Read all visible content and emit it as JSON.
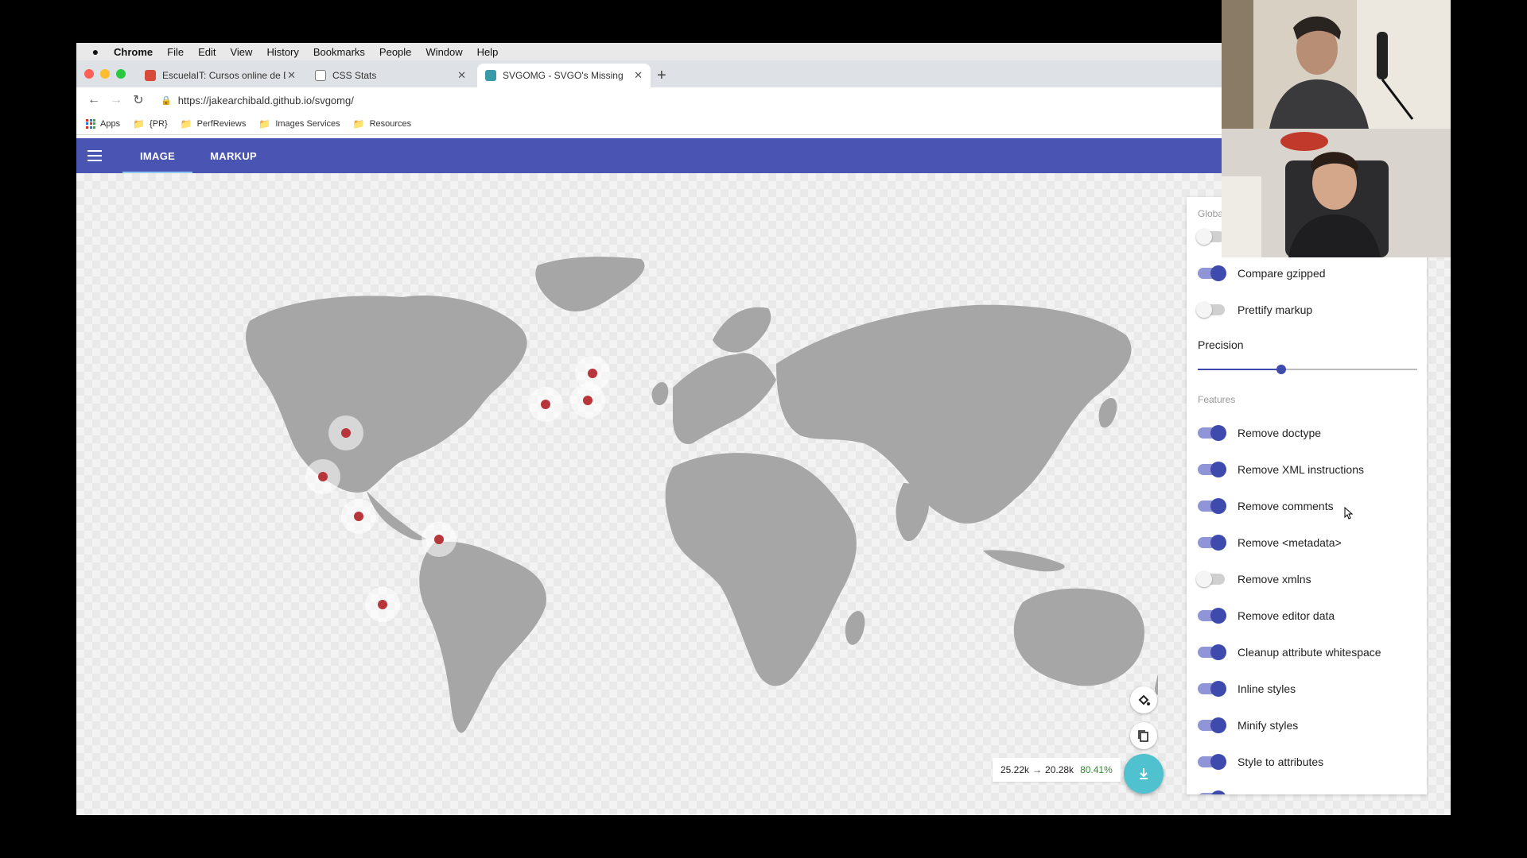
{
  "menubar": {
    "app": "Chrome",
    "items": [
      "File",
      "Edit",
      "View",
      "History",
      "Bookmarks",
      "People",
      "Window",
      "Help"
    ]
  },
  "tabs": [
    {
      "title": "EscuelaIT: Cursos online de De",
      "favicon_color": "#d84a38"
    },
    {
      "title": "CSS Stats",
      "favicon_color": "#444444"
    },
    {
      "title": "SVGOMG - SVGO's Missing GU",
      "favicon_color": "#3b9aa8"
    }
  ],
  "toolbar": {
    "url": "https://jakearchibald.github.io/svgomg/"
  },
  "bookmarks": {
    "apps": "Apps",
    "items": [
      "{PR}",
      "PerfReviews",
      "Images Services",
      "Resources"
    ]
  },
  "appbar": {
    "color": "#4a55b3",
    "tabs": [
      "IMAGE",
      "MARKUP"
    ]
  },
  "savings": {
    "from": "25.22k",
    "arrow": "→",
    "to": "20.28k",
    "percent": "80.41%"
  },
  "settings": {
    "global_label": "Global",
    "toggles_top": [
      {
        "label": "Compare gzipped",
        "on": true
      },
      {
        "label": "Prettify markup",
        "on": false
      }
    ],
    "precision_label": "Precision",
    "precision_value": 0.38,
    "features_label": "Features",
    "features": [
      {
        "label": "Remove doctype",
        "on": true
      },
      {
        "label": "Remove XML instructions",
        "on": true
      },
      {
        "label": "Remove comments",
        "on": true
      },
      {
        "label": "Remove <metadata>",
        "on": true
      },
      {
        "label": "Remove xmlns",
        "on": false
      },
      {
        "label": "Remove editor data",
        "on": true
      },
      {
        "label": "Cleanup attribute whitespace",
        "on": true
      },
      {
        "label": "Inline styles",
        "on": true
      },
      {
        "label": "Minify styles",
        "on": true
      },
      {
        "label": "Style to attributes",
        "on": true
      }
    ]
  },
  "map_pins": [
    {
      "name": "usa-east"
    },
    {
      "name": "central-america"
    },
    {
      "name": "colombia"
    },
    {
      "name": "brazil"
    },
    {
      "name": "argentina"
    },
    {
      "name": "spain"
    },
    {
      "name": "italy"
    },
    {
      "name": "germany"
    }
  ]
}
